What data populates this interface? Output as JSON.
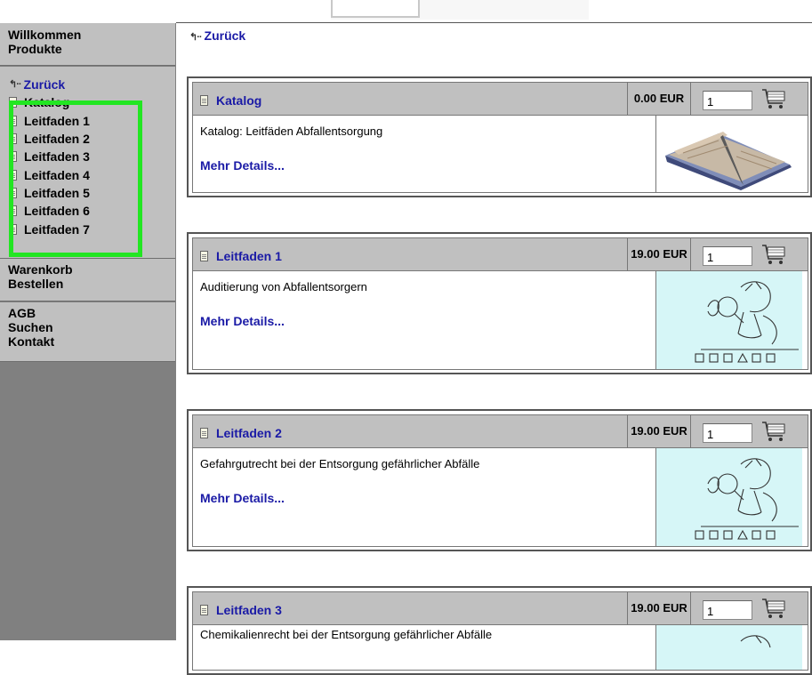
{
  "sidebar": {
    "top_items": [
      "Willkommen",
      "Produkte"
    ],
    "back_label": "Zurück",
    "sub_items": [
      "Katalog",
      "Leitfaden 1",
      "Leitfaden 2",
      "Leitfaden 3",
      "Leitfaden 4",
      "Leitfaden 5",
      "Leitfaden 6",
      "Leitfaden 7"
    ],
    "cart_items": [
      "Warenkorb",
      "Bestellen"
    ],
    "info_items": [
      "AGB",
      "Suchen",
      "Kontakt"
    ],
    "highlight_color": "#22e622"
  },
  "main": {
    "back_label": "Zurück",
    "products": [
      {
        "title": "Katalog",
        "price": "0.00 EUR",
        "qty": "1",
        "desc": "Katalog: Leitfäden Abfallentsorgung",
        "more": "Mehr Details...",
        "image": "open-book"
      },
      {
        "title": "Leitfaden 1",
        "price": "19.00 EUR",
        "qty": "1",
        "desc": "Auditierung von Abfallentsorgern",
        "more": "Mehr Details...",
        "image": "inspector-magnifier"
      },
      {
        "title": "Leitfaden 2",
        "price": "19.00 EUR",
        "qty": "1",
        "desc": "Gefahrgutrecht bei der Entsorgung gefährlicher Abfälle",
        "more": "Mehr Details...",
        "image": "inspector-magnifier"
      },
      {
        "title": "Leitfaden 3",
        "price": "19.00 EUR",
        "qty": "1",
        "desc": "Chemikalienrecht bei der Entsorgung gefährlicher Abfälle",
        "more": "",
        "image": "inspector-magnifier"
      }
    ]
  },
  "colors": {
    "link": "#1a1aa6",
    "sidebar_box": "#c0c0c0",
    "sidebar_bg": "#808080",
    "image_bg": "#d6f6f7"
  }
}
